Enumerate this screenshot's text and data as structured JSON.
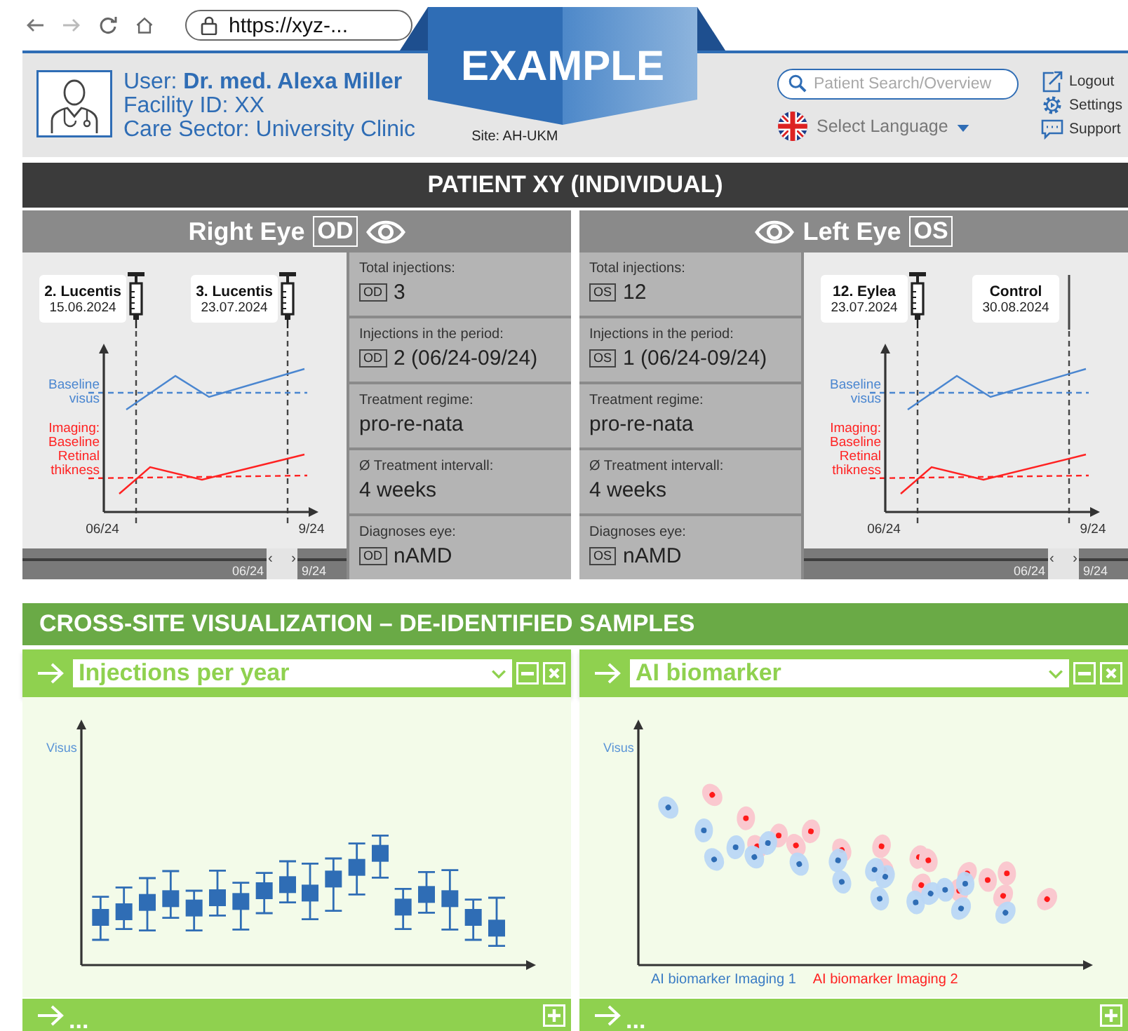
{
  "browser": {
    "url": "https://xyz-..."
  },
  "banner": {
    "label": "EXAMPLE"
  },
  "header": {
    "user": "User: **Dr. med. Alexa Miller**",
    "facility": "Facility ID: XX",
    "sector": "Care Sector: University Clinic",
    "site": "Site: AH-UKM",
    "search": {
      "placeholder": "Patient Search/Overview"
    },
    "language": "Select Language",
    "links": [
      {
        "kind": "logout",
        "label": "Logout"
      },
      {
        "kind": "settings",
        "label": "Settings"
      },
      {
        "kind": "support",
        "label": "Support"
      }
    ]
  },
  "patient_title": "PATIENT XY (INDIVIDUAL)",
  "eyes": [
    {
      "kind": "chart-first",
      "title": "Right Eye",
      "code": "OD",
      "visus_label": "Baseline visus",
      "thickness_label": "Imaging: Baseline Retinal thikness",
      "axis_start": "06/24",
      "axis_end": "9/24",
      "events": [
        {
          "kind": "injection",
          "name": "2. Lucentis",
          "date": "15.06.2024"
        },
        {
          "kind": "injection",
          "name": "3. Lucentis",
          "date": "23.07.2024"
        }
      ],
      "scroll": {
        "start": "06/24",
        "end": "9/24",
        "prev": "‹",
        "next": "›"
      },
      "stats": [
        {
          "label": "Total injections:",
          "code": "OD",
          "value": "3"
        },
        {
          "label": "Injections in the period:",
          "code": "OD",
          "value": "2 (06/24-09/24)"
        },
        {
          "label": "Treatment regime:",
          "value": "pro-re-nata"
        },
        {
          "label": "Ø Treatment intervall:",
          "value": "4 weeks"
        },
        {
          "label": "Diagnoses eye:",
          "code": "OD",
          "value": "nAMD"
        }
      ]
    },
    {
      "kind": "stats-first",
      "title": "Left Eye",
      "code": "OS",
      "visus_label": "Baseline visus",
      "thickness_label": "Imaging: Baseline Retinal thikness",
      "axis_start": "06/24",
      "axis_end": "9/24",
      "events": [
        {
          "kind": "injection",
          "name": "12. Eylea",
          "date": "23.07.2024"
        },
        {
          "kind": "control",
          "name": "Control",
          "date": "30.08.2024"
        }
      ],
      "scroll": {
        "start": "06/24",
        "end": "9/24",
        "prev": "‹",
        "next": "›"
      },
      "stats": [
        {
          "label": "Total injections:",
          "code": "OS",
          "value": "12"
        },
        {
          "label": "Injections in the period:",
          "code": "OS",
          "value": "1 (06/24-09/24)"
        },
        {
          "label": "Treatment regime:",
          "value": "pro-re-nata"
        },
        {
          "label": "Ø Treatment intervall:",
          "value": "4 weeks"
        },
        {
          "label": "Diagnoses eye:",
          "code": "OS",
          "value": "nAMD"
        }
      ]
    }
  ],
  "cross_site": {
    "title": "CROSS-SITE VISUALIZATION – DE-IDENTIFIED SAMPLES",
    "widgets": [
      {
        "kind": "boxplot",
        "title": "Injections per year",
        "axis_label": "Visus"
      },
      {
        "kind": "scatter",
        "title": "AI biomarker",
        "axis_label": "Visus",
        "legend": [
          {
            "label": "AI biomarker Imaging 1",
            "color": "#3a7cc4"
          },
          {
            "label": "AI biomarker Imaging 2",
            "color": "#ff2020"
          }
        ]
      }
    ],
    "collapsed": [
      {
        "label": "..."
      },
      {
        "label": "..."
      }
    ]
  }
}
